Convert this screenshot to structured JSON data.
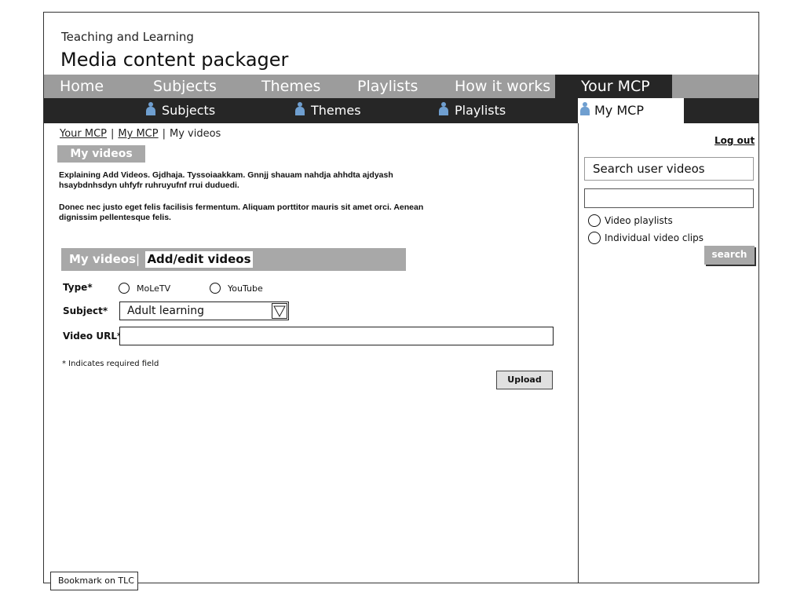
{
  "header": {
    "subtitle": "Teaching and Learning",
    "title": "Media content packager"
  },
  "top_nav": {
    "items": [
      "Home",
      "Subjects",
      "Themes",
      "Playlists",
      "How it works",
      "Your MCP"
    ],
    "active": "Your MCP"
  },
  "sub_nav": {
    "items": [
      "Subjects",
      "Themes",
      "Playlists"
    ],
    "active_tab": "My MCP"
  },
  "breadcrumb": {
    "links": [
      "Your MCP",
      "My MCP"
    ],
    "current": "My videos",
    "separator": "|"
  },
  "section_label": "My videos",
  "intro": {
    "paragraph1": "Explaining Add Videos. Gjdhaja. Tyssoiaakkam. Gnnjj shauam nahdja ahhdta ajdyash hsaybdnhsdyn uhfyfr ruhruyufnf rrui  duduedi.",
    "paragraph2": "Donec nec justo eget felis facilisis fermentum. Aliquam porttitor mauris sit amet orci. Aenean dignissim pellentesque felis."
  },
  "tabs": {
    "tab1": "My videos",
    "separator": "|",
    "tab2": "Add/edit videos"
  },
  "form": {
    "type_label": "Type*",
    "type_options": [
      "MoLeTV",
      "YouTube"
    ],
    "subject_label": "Subject*",
    "subject_value": "Adult learning",
    "url_label": "Video URL*",
    "url_value": "",
    "required_note": "* Indicates required field",
    "upload_label": "Upload"
  },
  "sidebar": {
    "logout_label": "Log out",
    "search_title": "Search user videos",
    "search_value": "",
    "options": [
      "Video playlists",
      "Individual video clips"
    ],
    "search_button": "search"
  },
  "bookmark_label": "Bookmark on TLC",
  "icons": {
    "nav_person": "person-icon",
    "dropdown": "dropdown-triangle-icon"
  },
  "colors": {
    "nav_gray": "#9c9c9c",
    "nav_dark": "#262626",
    "person_icon": "#6f9fd0",
    "button_gray": "#a8a8a8"
  }
}
